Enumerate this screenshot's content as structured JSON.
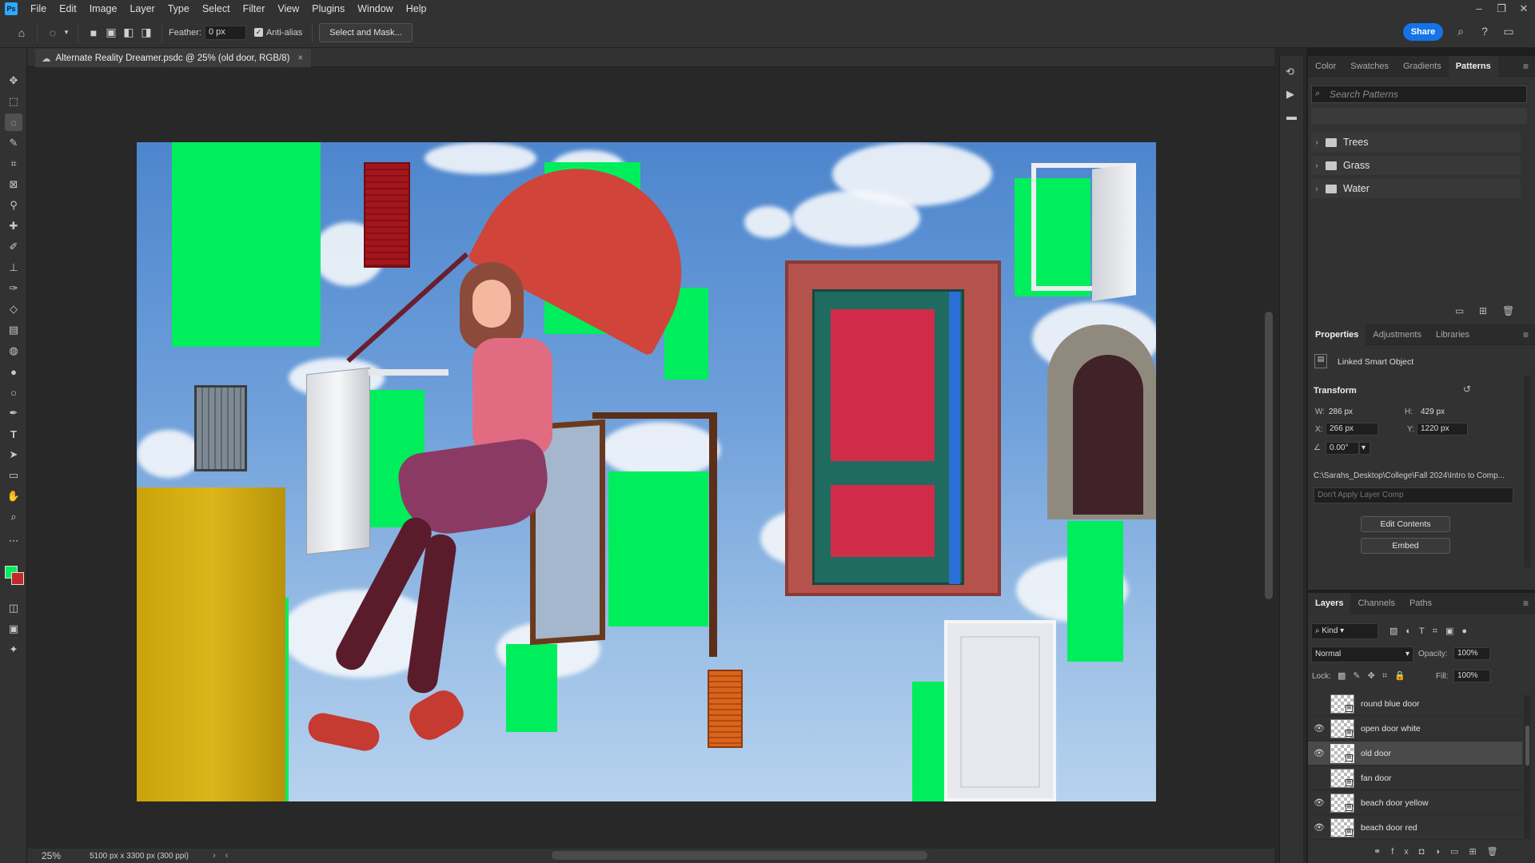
{
  "app": {
    "logo": "Ps",
    "menu": [
      "File",
      "Edit",
      "Image",
      "Layer",
      "Type",
      "Select",
      "Filter",
      "View",
      "Plugins",
      "Window",
      "Help"
    ],
    "window_controls": [
      "–",
      "❐",
      "✕"
    ]
  },
  "options_bar": {
    "feather_label": "Feather:",
    "feather_value": "0 px",
    "antialias_label": "Anti-alias",
    "select_mask_label": "Select and Mask...",
    "share_label": "Share"
  },
  "document": {
    "tab_title": "Alternate Reality Dreamer.psdc @ 25% (old door, RGB/8)",
    "zoom": "25%",
    "dimensions": "5100 px x 3300 px (300 ppi)"
  },
  "patterns_panel": {
    "tabs": [
      "Color",
      "Swatches",
      "Gradients",
      "Patterns"
    ],
    "active_tab": "Patterns",
    "search_placeholder": "Search Patterns",
    "folders": [
      "Trees",
      "Grass",
      "Water"
    ]
  },
  "properties_panel": {
    "tabs": [
      "Properties",
      "Adjustments",
      "Libraries"
    ],
    "object_type": "Linked Smart Object",
    "transform_label": "Transform",
    "w_label": "W:",
    "w_value": "286 px",
    "h_label": "H:",
    "h_value": "429 px",
    "x_label": "X:",
    "x_value": "266 px",
    "y_label": "Y:",
    "y_value": "1220 px",
    "angle_value": "0.00°",
    "path": "C:\\Sarahs_Desktop\\College\\Fall 2024\\Intro to Comp...",
    "layer_comp": "Don't Apply Layer Comp",
    "edit_contents": "Edit Contents",
    "embed": "Embed"
  },
  "layers_panel": {
    "tabs": [
      "Layers",
      "Channels",
      "Paths"
    ],
    "kind_label": "Kind",
    "blend_mode": "Normal",
    "opacity_label": "Opacity:",
    "opacity_value": "100%",
    "lock_label": "Lock:",
    "fill_label": "Fill:",
    "fill_value": "100%",
    "layers": [
      {
        "name": "round blue door",
        "visible": false
      },
      {
        "name": "open door white",
        "visible": true
      },
      {
        "name": "old door",
        "visible": true,
        "selected": true
      },
      {
        "name": "fan door",
        "visible": false
      },
      {
        "name": "beach door yellow",
        "visible": true
      },
      {
        "name": "beach door red",
        "visible": true
      }
    ]
  }
}
